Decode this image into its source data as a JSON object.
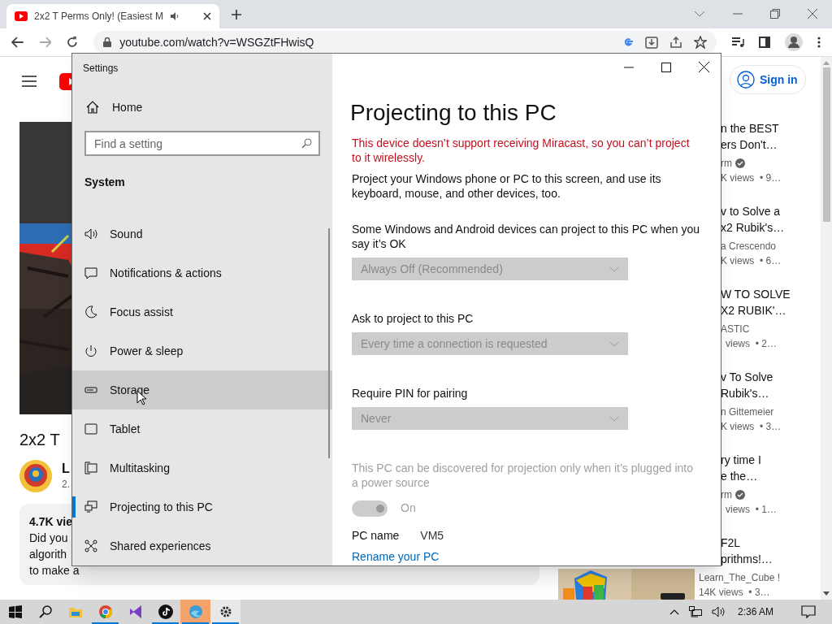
{
  "browser": {
    "tab": {
      "title": "2x2 T Perms Only! (Easiest M",
      "audio": true
    },
    "address": "youtube.com/watch?v=WSGZtFHwisQ"
  },
  "youtube": {
    "sign_in": "Sign in",
    "video_title": "2x2 T",
    "channel": "L",
    "subscribers": "2.",
    "description_lines": [
      "4.7K vie",
      "Did you",
      "algorith",
      "to make a"
    ],
    "recommended": [
      {
        "title_lines": [
          "n the BEST",
          "ers Don't…"
        ],
        "channel": "rm",
        "verified": true,
        "meta": "K views  • 9…"
      },
      {
        "title_lines": [
          "v to Solve a",
          "x2 Rubik's…"
        ],
        "channel": "a Crescendo",
        "verified": false,
        "meta": "K views  • 6…"
      },
      {
        "title_lines": [
          "W TO SOLVE",
          "X2 RUBIK'…"
        ],
        "channel": "ASTIC",
        "verified": false,
        "meta": "views  • 2…"
      },
      {
        "title_lines": [
          "v To Solve",
          "Rubik's…"
        ],
        "channel": "n Gittemeier",
        "verified": false,
        "meta": "K views  • 3…"
      },
      {
        "title_lines": [
          "ry time I",
          "e the…"
        ],
        "channel": "rm",
        "verified": true,
        "meta": "views  • 1…"
      },
      {
        "title_lines": [
          "F2L",
          "prithms!…"
        ],
        "channel": "Learn_The_Cube !",
        "verified": false,
        "meta": "14K views  • 3…"
      }
    ]
  },
  "settings": {
    "title": "Settings",
    "home": "Home",
    "search": {
      "placeholder": "Find a setting"
    },
    "section": "System",
    "nav": [
      {
        "label": "Sound",
        "selected": false,
        "hovered": false
      },
      {
        "label": "Notifications & actions",
        "selected": false,
        "hovered": false
      },
      {
        "label": "Focus assist",
        "selected": false,
        "hovered": false
      },
      {
        "label": "Power & sleep",
        "selected": false,
        "hovered": false
      },
      {
        "label": "Storage",
        "selected": false,
        "hovered": true
      },
      {
        "label": "Tablet",
        "selected": false,
        "hovered": false
      },
      {
        "label": "Multitasking",
        "selected": false,
        "hovered": false
      },
      {
        "label": "Projecting to this PC",
        "selected": true,
        "hovered": false
      },
      {
        "label": "Shared experiences",
        "selected": false,
        "hovered": false
      }
    ],
    "heading": "Projecting to this PC",
    "warning": "This device doesn’t support receiving Miracast, so you can’t project to it wirelessly.",
    "intro": "Project your Windows phone or PC to this screen, and use its keyboard, mouse, and other devices, too.",
    "dropdowns": [
      {
        "label": "Some Windows and Android devices can project to this PC when you say it’s OK",
        "value": "Always Off (Recommended)",
        "disabled": true
      },
      {
        "label": "Ask to project to this PC",
        "value": "Every time a connection is requested",
        "disabled": true
      },
      {
        "label": "Require PIN for pairing",
        "value": "Never",
        "disabled": true
      }
    ],
    "power_note": {
      "text": "This PC can be discovered for projection only when it’s plugged into a power source",
      "disabled": true
    },
    "toggle": {
      "on": true,
      "label": "On",
      "disabled": true
    },
    "pc_name": {
      "label": "PC name",
      "value": "VM5"
    },
    "rename_link": "Rename your PC"
  },
  "taskbar": {
    "apps": [
      {
        "kind": "explorer",
        "running": false,
        "selected": false
      },
      {
        "kind": "chrome",
        "running": true,
        "selected": false
      },
      {
        "kind": "studio",
        "running": false,
        "selected": false
      },
      {
        "kind": "tiktok",
        "running": true,
        "selected": false
      },
      {
        "kind": "edge",
        "running": true,
        "selected": true
      },
      {
        "kind": "settings",
        "running": true,
        "selected": false
      }
    ],
    "time": "2:36 AM"
  }
}
